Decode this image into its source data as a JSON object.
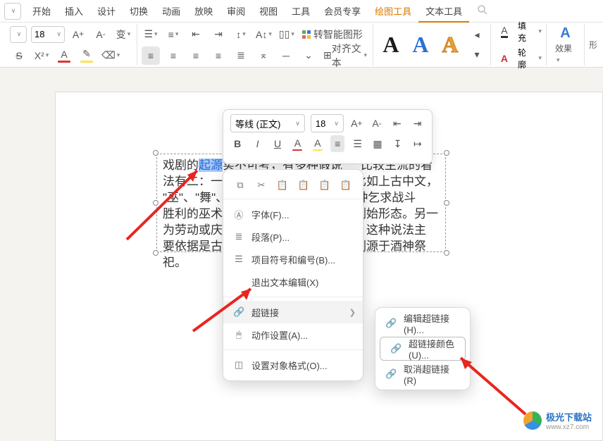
{
  "tabs": [
    "开始",
    "插入",
    "设计",
    "切换",
    "动画",
    "放映",
    "审阅",
    "视图",
    "工具",
    "会员专享"
  ],
  "tool_tabs": {
    "draw": "绘图工具",
    "text": "文本工具"
  },
  "ribbon": {
    "font_size": "18",
    "grow": "A⁺",
    "shrink": "A⁻",
    "caseBtn": "变",
    "fill_label": "填充",
    "outline_label": "轮廓",
    "effect_label": "效果",
    "shape_label": "形",
    "smart": "转智能图形",
    "alignText": "对齐文本"
  },
  "floatbar": {
    "font_name": "等线 (正文)",
    "font_size": "18"
  },
  "textbox": {
    "l1a": "戏剧的",
    "link": "起源",
    "l1b": "实不可考，有多种假说",
    "l1c": "比较主流的看",
    "l2": "法有二：一为原始宗教的巫术仪式。比如上古中文，",
    "l3": "\"巫\"、\"舞\"、\"武\"三字同音，可能是一种乞求战斗",
    "l4": "胜利的巫术活动中的表演，如今是戏剧始形态。另一",
    "l5": "为劳动或庆祝丰收时的即兴歌舞表演，这种说法主",
    "l6": "要依据是古希腊的戏剧起源，但在戏剧源于酒神祭祀。"
  },
  "ctx": {
    "font": "字体(F)...",
    "para": "段落(P)...",
    "bull": "项目符号和编号(B)...",
    "exit": "退出文本编辑(X)",
    "hyper": "超链接",
    "action": "动作设置(A)...",
    "format": "设置对象格式(O)..."
  },
  "sub": {
    "edit": "编辑超链接(H)...",
    "color": "超链接颜色(U)...",
    "cancel": "取消超链接(R)"
  },
  "wm": {
    "title": "极光下载站",
    "url": "www.xz7.com"
  }
}
